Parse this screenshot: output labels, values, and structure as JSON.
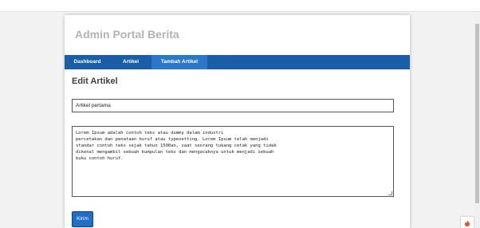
{
  "brand": "Admin Portal Berita",
  "nav": {
    "items": [
      {
        "label": "Dashboard"
      },
      {
        "label": "Artikel"
      },
      {
        "label": "Tambah Artikel"
      }
    ],
    "active": "Tambah Artikel"
  },
  "form": {
    "heading": "Edit Artikel",
    "title_value": "Artikel pertama",
    "content_value": "Lorem Ipsum adalah contoh teks atau dummy dalam industri\npercetakan dan penataan huruf atau typesetting. Lorem Ipsum telah menjadi\nstandar contoh teks sejak tahun 1500an, saat seorang tukang cetak yang tidak\ndikenal mengambil sebuah kumpulan teks dan mengacaknya untuk menjadi sebuah\nbuku contoh huruf.",
    "submit_label": "Kirim"
  },
  "colors": {
    "nav_bg": "#1a5ea8",
    "nav_active": "#2b78c8",
    "brand_text": "#b3b3b3",
    "button_bg": "#1f6fc5"
  },
  "icons": {
    "widget": "flame-icon"
  }
}
